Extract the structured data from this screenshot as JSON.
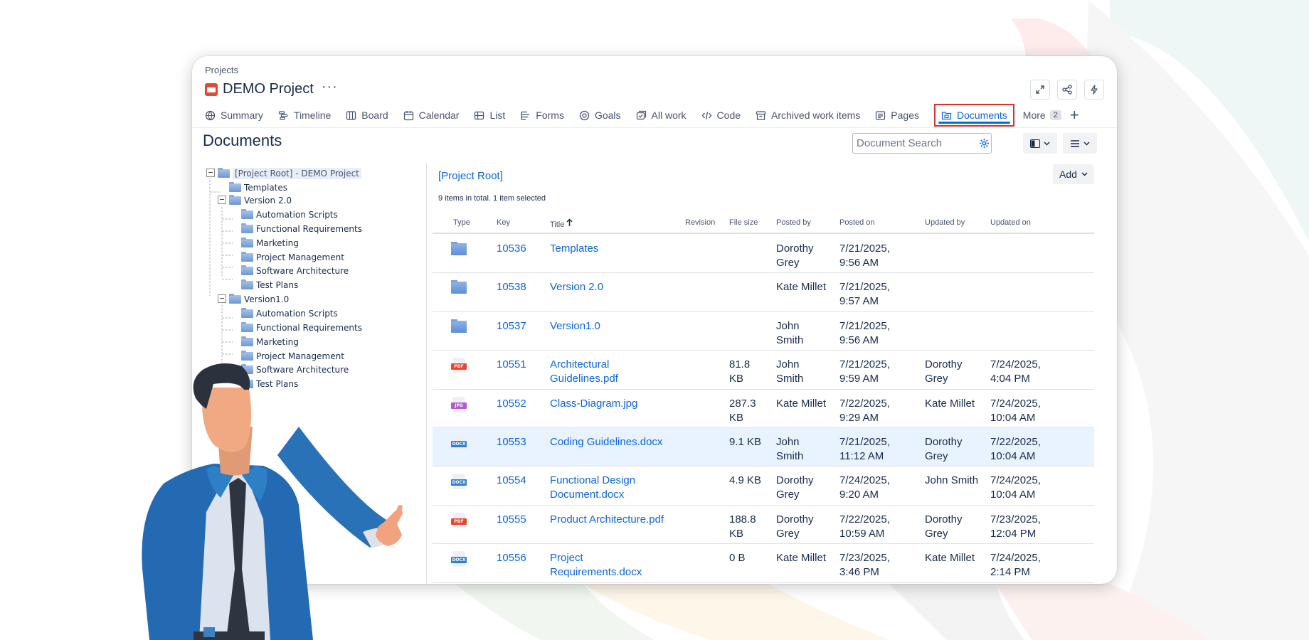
{
  "breadcrumb": "Projects",
  "project": {
    "name": "DEMO Project",
    "more": "···"
  },
  "tabs": [
    {
      "label": "Summary",
      "icon": "globe-icon"
    },
    {
      "label": "Timeline",
      "icon": "timeline-icon"
    },
    {
      "label": "Board",
      "icon": "board-icon"
    },
    {
      "label": "Calendar",
      "icon": "calendar-icon"
    },
    {
      "label": "List",
      "icon": "list-icon"
    },
    {
      "label": "Forms",
      "icon": "forms-icon"
    },
    {
      "label": "Goals",
      "icon": "goals-icon"
    },
    {
      "label": "All work",
      "icon": "all-work-icon"
    },
    {
      "label": "Code",
      "icon": "code-icon"
    },
    {
      "label": "Archived work items",
      "icon": "archive-icon"
    },
    {
      "label": "Pages",
      "icon": "pages-icon"
    },
    {
      "label": "Documents",
      "icon": "documents-icon",
      "active": true
    },
    {
      "label": "More",
      "badge": "2"
    }
  ],
  "page_title": "Documents",
  "search": {
    "placeholder": "Document Search"
  },
  "tree": {
    "root": "[Project Root] - DEMO Project",
    "templates": "Templates",
    "version2": "Version 2.0",
    "version2_children": [
      "Automation Scripts",
      "Functional Requirements",
      "Marketing",
      "Project Management",
      "Software Architecture",
      "Test Plans"
    ],
    "version1": "Version1.0",
    "version1_children": [
      "Automation Scripts",
      "Functional Requirements",
      "Marketing",
      "Project Management",
      "Software Architecture",
      "Test Plans"
    ]
  },
  "list": {
    "root_link": "[Project Root]",
    "add_label": "Add",
    "count_text": "9 items in total. 1 item selected",
    "columns": {
      "type": "Type",
      "key": "Key",
      "title": "Title",
      "revision": "Revision",
      "size": "File size",
      "posted_by": "Posted by",
      "posted_on": "Posted on",
      "updated_by": "Updated by",
      "updated_on": "Updated on"
    },
    "rows": [
      {
        "type": "folder",
        "key": "10536",
        "title": "Templates",
        "size": "",
        "posted_by": "Dorothy Grey",
        "posted_on": "7/21/2025, 9:56 AM",
        "updated_by": "",
        "updated_on": ""
      },
      {
        "type": "folder",
        "key": "10538",
        "title": "Version 2.0",
        "size": "",
        "posted_by": "Kate Millet",
        "posted_on": "7/21/2025, 9:57 AM",
        "updated_by": "",
        "updated_on": ""
      },
      {
        "type": "folder",
        "key": "10537",
        "title": "Version1.0",
        "size": "",
        "posted_by": "John Smith",
        "posted_on": "7/21/2025, 9:56 AM",
        "updated_by": "",
        "updated_on": ""
      },
      {
        "type": "PDF",
        "key": "10551",
        "title": "Architectural Guidelines.pdf",
        "size": "81.8 KB",
        "posted_by": "John Smith",
        "posted_on": "7/21/2025, 9:59 AM",
        "updated_by": "Dorothy Grey",
        "updated_on": "7/24/2025, 4:04 PM"
      },
      {
        "type": "JPG",
        "key": "10552",
        "title": "Class-Diagram.jpg",
        "size": "287.3 KB",
        "posted_by": "Kate Millet",
        "posted_on": "7/22/2025, 9:29 AM",
        "updated_by": "Kate Millet",
        "updated_on": "7/24/2025, 10:04 AM"
      },
      {
        "type": "DOCX",
        "key": "10553",
        "title": "Coding Guidelines.docx",
        "size": "9.1 KB",
        "posted_by": "John Smith",
        "posted_on": "7/21/2025, 11:12 AM",
        "updated_by": "Dorothy Grey",
        "updated_on": "7/22/2025, 10:04 AM",
        "selected": true
      },
      {
        "type": "DOCX",
        "key": "10554",
        "title": "Functional Design Document.docx",
        "size": "4.9 KB",
        "posted_by": "Dorothy Grey",
        "posted_on": "7/24/2025, 9:20 AM",
        "updated_by": "John Smith",
        "updated_on": "7/24/2025, 10:04 AM"
      },
      {
        "type": "PDF",
        "key": "10555",
        "title": "Product Architecture.pdf",
        "size": "188.8 KB",
        "posted_by": "Dorothy Grey",
        "posted_on": "7/22/2025, 10:59 AM",
        "updated_by": "Dorothy Grey",
        "updated_on": "7/23/2025, 12:04 PM"
      },
      {
        "type": "DOCX",
        "key": "10556",
        "title": "Project Requirements.docx",
        "size": "0 B",
        "posted_by": "Kate Millet",
        "posted_on": "7/23/2025, 3:46 PM",
        "updated_by": "Kate Millet",
        "updated_on": "7/24/2025, 2:14 PM"
      }
    ]
  },
  "colors": {
    "accent": "#0c66e4",
    "highlight_border": "#d93030",
    "pdf": "#e8462f",
    "jpg": "#b45ad1",
    "docx": "#2f7fd6",
    "selected_row": "#e9f2ff"
  }
}
